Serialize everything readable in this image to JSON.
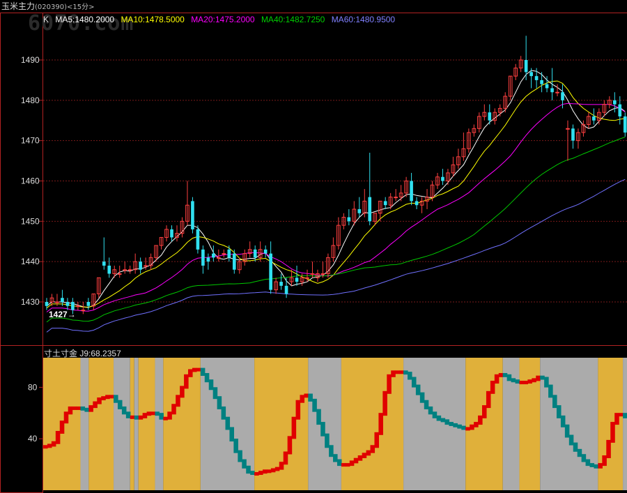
{
  "header": {
    "title": "玉米主力",
    "code": "(020390)<15分>",
    "watermark": "6070.com"
  },
  "colors": {
    "bg": "#000000",
    "frame": "#b22222",
    "grid": "#7a1a1a",
    "up_candle": "#ff4040",
    "down_candle": "#30e0f0",
    "ma5": "#ffffff",
    "ma10": "#ffff00",
    "ma20": "#ff00ff",
    "ma40": "#00c800",
    "ma60": "#7070ff",
    "gold": "#e0b03a",
    "gray": "#ababab",
    "step_up": "#e00000",
    "step_down": "#008080"
  },
  "legend": {
    "k": "K",
    "ma5": "MA5:1480.2000",
    "ma10": "MA10:1478.5000",
    "ma20": "MA20:1475.2000",
    "ma40": "MA40:1482.7250",
    "ma60": "MA60:1480.9500"
  },
  "sub_legend": {
    "name": "寸土寸金",
    "value": "J9:68.2357"
  },
  "chart_data": [
    {
      "type": "candlestick",
      "title": "",
      "y_ticks": [
        "1490",
        "1480",
        "1470",
        "1460",
        "1450",
        "1440",
        "1430"
      ],
      "ylim": [
        1417.5,
        1496
      ],
      "grid": true,
      "annotation": "1427→",
      "candles": [
        [
          1430,
          1431,
          1429,
          1428
        ],
        [
          1430,
          1432,
          1431,
          1429
        ],
        [
          1430,
          1432,
          1430,
          1429
        ],
        [
          1431,
          1433,
          1430,
          1429
        ],
        [
          1430,
          1431,
          1429,
          1428
        ],
        [
          1430,
          1431,
          1428,
          1427
        ],
        [
          1429,
          1430,
          1429,
          1428
        ],
        [
          1428,
          1430,
          1428,
          1427
        ],
        [
          1430,
          1431,
          1429,
          1428
        ],
        [
          1429,
          1432,
          1432,
          1428
        ],
        [
          1432,
          1436,
          1436,
          1431
        ],
        [
          1440,
          1446,
          1439,
          1438
        ],
        [
          1439,
          1441,
          1437,
          1436
        ],
        [
          1437,
          1439,
          1438,
          1436
        ],
        [
          1437,
          1439,
          1437,
          1436
        ],
        [
          1438,
          1440,
          1438,
          1437
        ],
        [
          1438,
          1439,
          1438,
          1437
        ],
        [
          1438,
          1442,
          1440,
          1437
        ],
        [
          1440,
          1441,
          1438,
          1437
        ],
        [
          1439,
          1441,
          1439,
          1438
        ],
        [
          1439,
          1442,
          1441,
          1438
        ],
        [
          1441,
          1444,
          1444,
          1440
        ],
        [
          1444,
          1446,
          1446,
          1443
        ],
        [
          1446,
          1449,
          1448,
          1445
        ],
        [
          1448,
          1449,
          1446,
          1445
        ],
        [
          1446,
          1449,
          1447,
          1445
        ],
        [
          1447,
          1451,
          1450,
          1446
        ],
        [
          1450,
          1460,
          1454,
          1449
        ],
        [
          1455,
          1456,
          1448,
          1447
        ],
        [
          1448,
          1449,
          1443,
          1442
        ],
        [
          1443,
          1444,
          1439,
          1437
        ],
        [
          1441,
          1442,
          1440,
          1438
        ],
        [
          1442,
          1444,
          1441,
          1440
        ],
        [
          1441,
          1443,
          1441,
          1440
        ],
        [
          1442,
          1443,
          1442,
          1441
        ],
        [
          1443,
          1444,
          1441,
          1440
        ],
        [
          1442,
          1443,
          1438,
          1437
        ],
        [
          1438,
          1441,
          1440,
          1437
        ],
        [
          1440,
          1443,
          1442,
          1439
        ],
        [
          1442,
          1445,
          1443,
          1441
        ],
        [
          1443,
          1444,
          1441,
          1440
        ],
        [
          1441,
          1445,
          1443,
          1440
        ],
        [
          1443,
          1444,
          1442,
          1441
        ],
        [
          1442,
          1445,
          1433,
          1432
        ],
        [
          1433,
          1436,
          1435,
          1432
        ],
        [
          1435,
          1437,
          1434,
          1433
        ],
        [
          1434,
          1436,
          1432,
          1431
        ],
        [
          1435,
          1438,
          1436,
          1434
        ],
        [
          1436,
          1439,
          1435,
          1434
        ],
        [
          1435,
          1437,
          1436,
          1434
        ],
        [
          1436,
          1438,
          1436,
          1435
        ],
        [
          1437,
          1440,
          1437,
          1436
        ],
        [
          1436,
          1438,
          1437,
          1435
        ],
        [
          1437,
          1440,
          1437,
          1436
        ],
        [
          1437,
          1442,
          1441,
          1436
        ],
        [
          1441,
          1446,
          1444,
          1440
        ],
        [
          1444,
          1451,
          1449,
          1443
        ],
        [
          1449,
          1452,
          1451,
          1448
        ],
        [
          1451,
          1453,
          1450,
          1449
        ],
        [
          1450,
          1455,
          1453,
          1449
        ],
        [
          1453,
          1456,
          1452,
          1451
        ],
        [
          1452,
          1458,
          1455,
          1451
        ],
        [
          1456,
          1467,
          1450,
          1449
        ],
        [
          1450,
          1452,
          1452,
          1449
        ],
        [
          1452,
          1455,
          1455,
          1450
        ],
        [
          1455,
          1456,
          1454,
          1453
        ],
        [
          1454,
          1457,
          1456,
          1453
        ],
        [
          1456,
          1458,
          1456,
          1455
        ],
        [
          1456,
          1459,
          1457,
          1455
        ],
        [
          1457,
          1461,
          1460,
          1456
        ],
        [
          1460,
          1462,
          1455,
          1454
        ],
        [
          1455,
          1456,
          1454,
          1453
        ],
        [
          1454,
          1456,
          1455,
          1452
        ],
        [
          1455,
          1458,
          1456,
          1453
        ],
        [
          1456,
          1460,
          1459,
          1455
        ],
        [
          1459,
          1462,
          1461,
          1458
        ],
        [
          1461,
          1463,
          1460,
          1459
        ],
        [
          1460,
          1463,
          1462,
          1459
        ],
        [
          1462,
          1466,
          1464,
          1461
        ],
        [
          1464,
          1468,
          1466,
          1463
        ],
        [
          1466,
          1472,
          1468,
          1465
        ],
        [
          1468,
          1473,
          1472,
          1467
        ],
        [
          1472,
          1474,
          1473,
          1471
        ],
        [
          1473,
          1477,
          1476,
          1472
        ],
        [
          1476,
          1479,
          1477,
          1475
        ],
        [
          1477,
          1479,
          1475,
          1474
        ],
        [
          1475,
          1478,
          1477,
          1474
        ],
        [
          1477,
          1479,
          1478,
          1476
        ],
        [
          1478,
          1482,
          1481,
          1477
        ],
        [
          1481,
          1486,
          1486,
          1480
        ],
        [
          1486,
          1489,
          1488,
          1485
        ],
        [
          1488,
          1491,
          1490,
          1487
        ],
        [
          1490,
          1496,
          1487,
          1485
        ],
        [
          1487,
          1488,
          1486,
          1483
        ],
        [
          1486,
          1488,
          1485,
          1483
        ],
        [
          1485,
          1487,
          1484,
          1482
        ],
        [
          1484,
          1486,
          1483,
          1482
        ],
        [
          1483,
          1488,
          1482,
          1480
        ],
        [
          1482,
          1484,
          1482,
          1481
        ],
        [
          1482,
          1484,
          1480,
          1478
        ],
        [
          1473,
          1475,
          1473,
          1465
        ],
        [
          1473,
          1474,
          1470,
          1468
        ],
        [
          1470,
          1473,
          1472,
          1468
        ],
        [
          1472,
          1475,
          1474,
          1471
        ],
        [
          1474,
          1477,
          1476,
          1473
        ],
        [
          1476,
          1478,
          1475,
          1474
        ],
        [
          1475,
          1478,
          1477,
          1474
        ],
        [
          1477,
          1480,
          1479,
          1476
        ],
        [
          1479,
          1481,
          1480,
          1478
        ],
        [
          1480,
          1482,
          1479,
          1477
        ],
        [
          1479,
          1481,
          1476,
          1474
        ],
        [
          1476,
          1477,
          1472,
          1471
        ]
      ],
      "ma_start": {
        "ma10": 1,
        "ma20": 3,
        "ma40": 0,
        "ma60": 0
      }
    },
    {
      "type": "step",
      "title": "",
      "y_ticks": [
        "80",
        "40"
      ],
      "ylim": [
        0,
        103
      ],
      "series_name": "J9",
      "values": [
        34,
        35,
        37,
        45,
        53,
        60,
        64,
        64,
        64,
        63,
        62,
        65,
        68,
        71,
        72,
        73,
        73,
        69,
        64,
        60,
        57,
        57,
        56,
        57,
        59,
        60,
        60,
        59,
        56,
        56,
        60,
        66,
        73,
        80,
        89,
        93,
        94,
        94,
        90,
        85,
        79,
        72,
        64,
        56,
        48,
        39,
        30,
        23,
        18,
        14,
        13,
        13,
        14,
        15,
        15,
        16,
        17,
        21,
        29,
        41,
        56,
        69,
        73,
        74,
        70,
        62,
        52,
        43,
        34,
        27,
        23,
        20,
        20,
        20,
        22,
        24,
        26,
        28,
        30,
        34,
        44,
        59,
        76,
        89,
        92,
        92,
        92,
        91,
        87,
        81,
        75,
        69,
        64,
        60,
        57,
        55,
        54,
        52,
        51,
        50,
        49,
        48,
        48,
        50,
        52,
        57,
        65,
        76,
        84,
        89,
        90,
        89,
        86,
        85,
        84,
        84,
        84,
        85,
        86,
        88,
        87,
        81,
        73,
        65,
        57,
        50,
        42,
        36,
        31,
        27,
        23,
        20,
        19,
        18,
        20,
        26,
        38,
        52,
        59,
        59,
        57
      ]
    }
  ]
}
